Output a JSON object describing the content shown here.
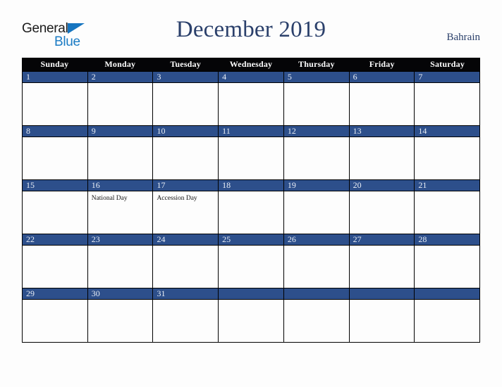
{
  "brand": {
    "name_part1": "General",
    "name_part2": "Blue",
    "color_dark": "#1b1b1b",
    "color_blue": "#1a7bc4"
  },
  "header": {
    "title": "December 2019",
    "country": "Bahrain",
    "title_color": "#2b406b"
  },
  "calendar": {
    "weekday_header_bg": "#050507",
    "date_band_bg": "#2d4f8b",
    "weekdays": [
      "Sunday",
      "Monday",
      "Tuesday",
      "Wednesday",
      "Thursday",
      "Friday",
      "Saturday"
    ],
    "weeks": [
      [
        {
          "number": "1",
          "event": ""
        },
        {
          "number": "2",
          "event": ""
        },
        {
          "number": "3",
          "event": ""
        },
        {
          "number": "4",
          "event": ""
        },
        {
          "number": "5",
          "event": ""
        },
        {
          "number": "6",
          "event": ""
        },
        {
          "number": "7",
          "event": ""
        }
      ],
      [
        {
          "number": "8",
          "event": ""
        },
        {
          "number": "9",
          "event": ""
        },
        {
          "number": "10",
          "event": ""
        },
        {
          "number": "11",
          "event": ""
        },
        {
          "number": "12",
          "event": ""
        },
        {
          "number": "13",
          "event": ""
        },
        {
          "number": "14",
          "event": ""
        }
      ],
      [
        {
          "number": "15",
          "event": ""
        },
        {
          "number": "16",
          "event": "National Day"
        },
        {
          "number": "17",
          "event": "Accession Day"
        },
        {
          "number": "18",
          "event": ""
        },
        {
          "number": "19",
          "event": ""
        },
        {
          "number": "20",
          "event": ""
        },
        {
          "number": "21",
          "event": ""
        }
      ],
      [
        {
          "number": "22",
          "event": ""
        },
        {
          "number": "23",
          "event": ""
        },
        {
          "number": "24",
          "event": ""
        },
        {
          "number": "25",
          "event": ""
        },
        {
          "number": "26",
          "event": ""
        },
        {
          "number": "27",
          "event": ""
        },
        {
          "number": "28",
          "event": ""
        }
      ],
      [
        {
          "number": "29",
          "event": ""
        },
        {
          "number": "30",
          "event": ""
        },
        {
          "number": "31",
          "event": ""
        },
        {
          "number": "",
          "event": ""
        },
        {
          "number": "",
          "event": ""
        },
        {
          "number": "",
          "event": ""
        },
        {
          "number": "",
          "event": ""
        }
      ]
    ]
  }
}
